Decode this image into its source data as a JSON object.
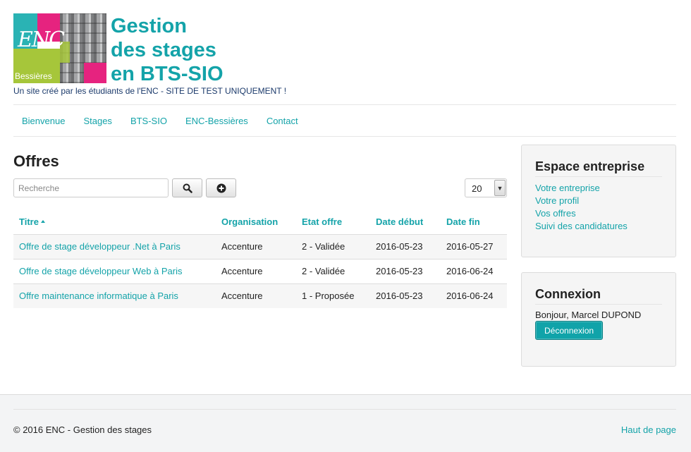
{
  "header": {
    "logo_text": "ENC",
    "logo_subtext": "Bessières",
    "title_lines": [
      "Gestion",
      "des stages",
      "en BTS-SIO"
    ],
    "tagline": "Un site créé par les étudiants de l'ENC - SITE DE TEST UNIQUEMENT !"
  },
  "nav": {
    "items": [
      "Bienvenue",
      "Stages",
      "BTS-SIO",
      "ENC-Bessières",
      "Contact"
    ]
  },
  "main": {
    "heading": "Offres",
    "search_placeholder": "Recherche",
    "page_size": "20",
    "table": {
      "columns": [
        "Titre",
        "Organisation",
        "Etat offre",
        "Date début",
        "Date fin"
      ],
      "rows": [
        [
          "Offre de stage développeur .Net à Paris",
          "Accenture",
          "2 - Validée",
          "2016-05-23",
          "2016-05-27"
        ],
        [
          "Offre de stage développeur Web à Paris",
          "Accenture",
          "2 - Validée",
          "2016-05-23",
          "2016-06-24"
        ],
        [
          "Offre maintenance informatique à Paris",
          "Accenture",
          "1 - Proposée",
          "2016-05-23",
          "2016-06-24"
        ]
      ]
    }
  },
  "sidebar": {
    "espace": {
      "title": "Espace entreprise",
      "links": [
        "Votre entreprise",
        "Votre profil",
        "Vos offres",
        "Suivi des candidatures"
      ]
    },
    "connexion": {
      "title": "Connexion",
      "greeting": "Bonjour, Marcel DUPOND",
      "logout_label": "Déconnexion"
    }
  },
  "footer": {
    "copyright": "© 2016 ENC - Gestion des stages",
    "back_to_top": "Haut de page"
  },
  "colors": {
    "accent": "#14a3a9",
    "button": "#10a3a9"
  }
}
